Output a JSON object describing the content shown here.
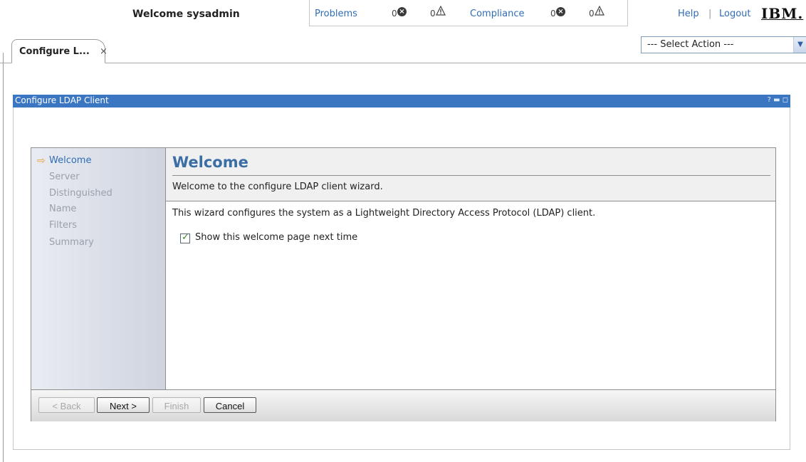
{
  "header": {
    "welcome": "Welcome sysadmin",
    "problems_label": "Problems",
    "problems_errors": "0",
    "problems_warnings": "0",
    "compliance_label": "Compliance",
    "compliance_errors": "0",
    "compliance_warnings": "0",
    "help": "Help",
    "separator": "|",
    "logout": "Logout",
    "logo": "IBM."
  },
  "tabs": [
    {
      "label": "Configure L...",
      "close": "×"
    }
  ],
  "action_select": {
    "value": "--- Select Action ---",
    "arrow": "▼"
  },
  "portlet": {
    "title": "Configure LDAP Client",
    "controls": "? ▬ ◻"
  },
  "wizard": {
    "steps": [
      {
        "label": "Welcome",
        "active": true
      },
      {
        "label": "Server",
        "active": false
      },
      {
        "label": "Distinguished",
        "active": false
      },
      {
        "label": "Name",
        "active": false
      },
      {
        "label": "Filters",
        "active": false
      },
      {
        "label": "Summary",
        "active": false
      }
    ],
    "current_arrow": "⇨",
    "title": "Welcome",
    "subtitle": "Welcome to the configure LDAP client wizard.",
    "description": "This wizard configures the system as a Lightweight Directory Access Protocol (LDAP) client.",
    "checkbox_label": "Show this welcome page next time",
    "checkbox_checked": true,
    "checkbox_mark": "✓",
    "buttons": {
      "back": "< Back",
      "next": "Next >",
      "finish": "Finish",
      "cancel": "Cancel"
    }
  },
  "colors": {
    "accent": "#3b76c2",
    "link": "#2f6db4",
    "title": "#3a6ea5"
  },
  "icons": {
    "error": "error-circle-icon",
    "warning": "warning-triangle-icon",
    "nav_current": "arrow-right-icon"
  }
}
